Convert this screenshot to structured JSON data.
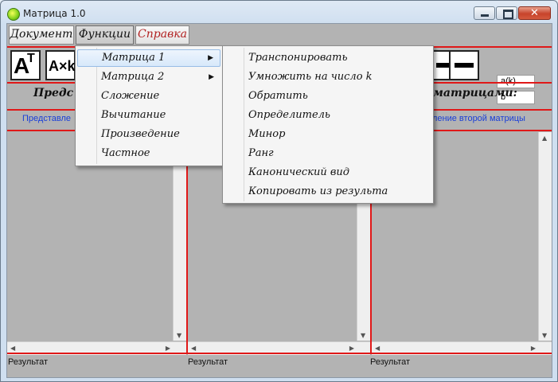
{
  "window": {
    "title": "Матрица 1.0",
    "minimize_icon": "minimize-icon",
    "maximize_icon": "maximize-icon",
    "close_glyph": "✕"
  },
  "menubar": {
    "document": "Документ",
    "functions": "Функции",
    "help": "Справка"
  },
  "toolbar": {
    "transpose_main": "A",
    "transpose_sup": "T",
    "multiply": "A×k",
    "field_a": "a(k)",
    "field_b": "b"
  },
  "headings": {
    "left": "Предс",
    "right": "д матрицами:"
  },
  "subheadings": {
    "left": "Представле",
    "right": "ление второй матрицы"
  },
  "results": {
    "r1": "Результат",
    "r2": "Результат",
    "r3": "Результат"
  },
  "functions_menu": {
    "items": [
      {
        "label": "Матрица 1",
        "has_submenu": true,
        "highlighted": true
      },
      {
        "label": "Матрица 2",
        "has_submenu": true
      },
      {
        "label": "Сложение"
      },
      {
        "label": "Вычитание"
      },
      {
        "label": "Произведение"
      },
      {
        "label": "Частное"
      }
    ]
  },
  "matrix1_submenu": {
    "items": [
      {
        "label": "Транспонировать"
      },
      {
        "label": "Умножить на число k"
      },
      {
        "label": "Обратить"
      },
      {
        "label": "Определитель"
      },
      {
        "label": "Минор"
      },
      {
        "label": "Ранг"
      },
      {
        "label": "Канонический вид"
      },
      {
        "label": "Копировать из результа"
      }
    ]
  },
  "colors": {
    "accent_red": "#e01818",
    "link_blue": "#1a3fd8",
    "help_red": "#b22222",
    "client_gray": "#b3b3b3"
  }
}
